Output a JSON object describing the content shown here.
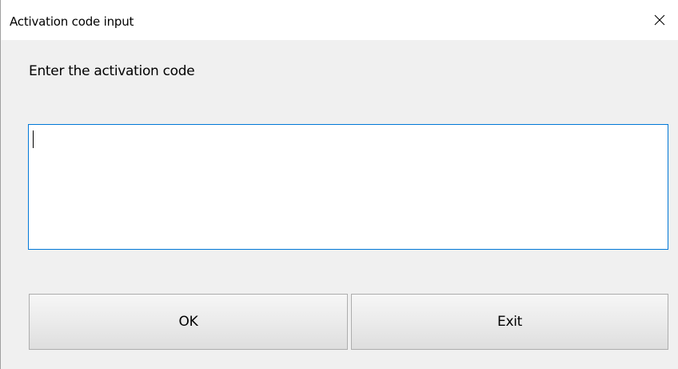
{
  "window": {
    "title": "Activation code input",
    "close_icon": "close-icon"
  },
  "form": {
    "prompt": "Enter the activation code",
    "input_value": "",
    "input_placeholder": ""
  },
  "buttons": {
    "ok_label": "OK",
    "exit_label": "Exit"
  },
  "colors": {
    "input_focus_border": "#0078d7",
    "dialog_background": "#f0f0f0",
    "titlebar_background": "#ffffff"
  }
}
